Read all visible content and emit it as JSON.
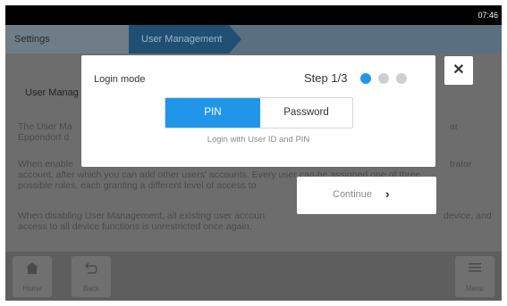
{
  "status_bar": {
    "time": "07:46"
  },
  "breadcrumb": {
    "items": [
      "Settings",
      "User Management"
    ]
  },
  "content": {
    "title": "User Manag",
    "paragraph1_left": "The User Ma",
    "paragraph1_left2": "Eppendorf d",
    "paragraph1_right": "ar",
    "paragraph2_left": "When enable",
    "paragraph2_right": "trator",
    "paragraph2_line2": "account, after which you can add other users' accounts. Every user can be assigned one of three",
    "paragraph2_line3": "possible roles, each granting a different level of access to",
    "paragraph3_line1_left": "When disabling User Management, all existing user accoun",
    "paragraph3_line1_right": "device, and",
    "paragraph3_line2": "access to all device functions is unrestricted once again."
  },
  "dialog": {
    "title": "Login mode",
    "step": "Step 1/3",
    "options": [
      "PIN",
      "Password"
    ],
    "selected": "PIN",
    "hint": "Login with User ID and PIN",
    "close_symbol": "✕",
    "continue_label": "Continue",
    "continue_icon": "chevron-right-icon"
  },
  "bottom_nav": {
    "home_label": "Home",
    "back_label": "Back",
    "menu_label": "Menu"
  },
  "colors": {
    "accent": "#2196e8",
    "breadcrumb_active": "#1f4f73",
    "inactive_dot": "#cfcfcf"
  }
}
